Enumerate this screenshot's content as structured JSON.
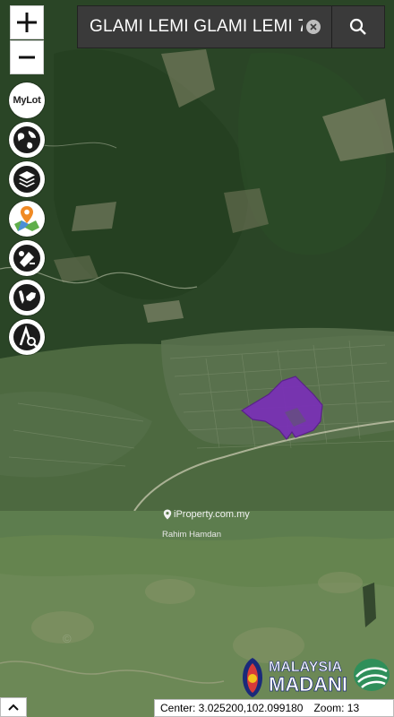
{
  "search": {
    "value": "GLAMI LEMI GLAMI LEMI 7",
    "placeholder": ""
  },
  "tools": [
    {
      "name": "mylot-icon",
      "label": "MyLot"
    },
    {
      "name": "globe-icon"
    },
    {
      "name": "layers-icon"
    },
    {
      "name": "map-pin-icon"
    },
    {
      "name": "measure-icon"
    },
    {
      "name": "malaysia-map-icon"
    },
    {
      "name": "measure-area-icon"
    }
  ],
  "watermark": {
    "brand": "iProperty.com.my",
    "agent": "Rahim Hamdan"
  },
  "logo": {
    "line1": "MALAYSIA",
    "line2": "MADANI"
  },
  "status": {
    "center": "Center: 3.025200,102.099180",
    "zoom": "Zoom: 13"
  },
  "colors": {
    "highlight": "#7a2fb8",
    "forest": "#2e4a28"
  }
}
